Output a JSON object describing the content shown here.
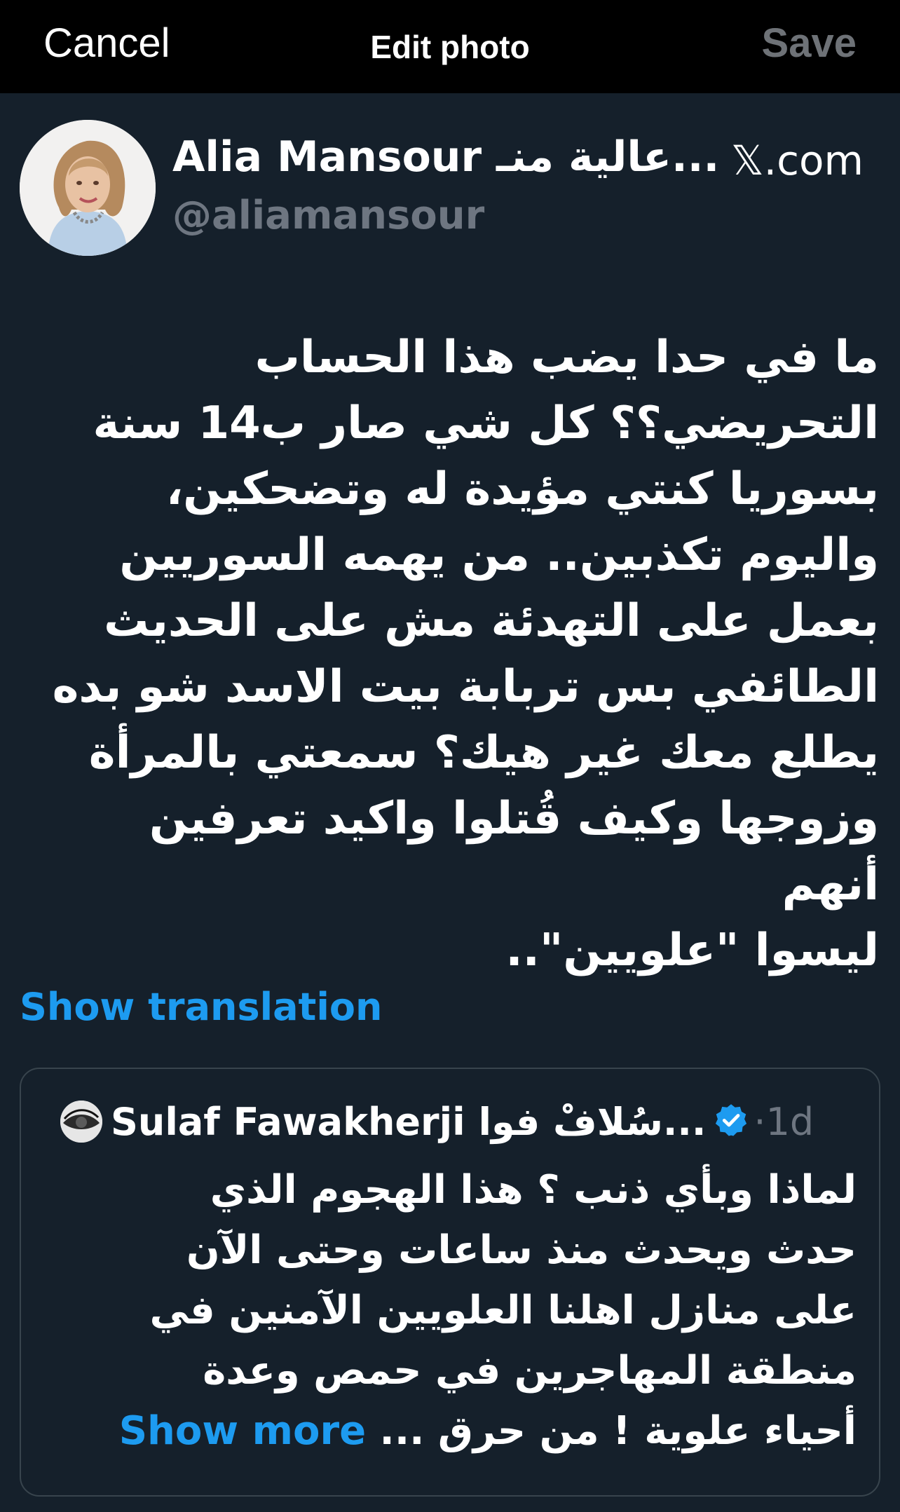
{
  "topbar": {
    "cancel_label": "Cancel",
    "title": "Edit photo",
    "save_label": "Save",
    "save_color": "#6e7277"
  },
  "tweet": {
    "display_name": "Alia Mansour عالية منـ...",
    "handle": "@aliamansour",
    "source": "𝕏.com",
    "avatar_icon": "profile-photo",
    "body_lines": [
      "ما في حدا يضب هذا الحساب",
      "التحريضي؟؟ كل شي صار ب14 سنة",
      "بسوريا كنتي مؤيدة له وتضحكين،",
      "واليوم تكذبين.. من يهمه السوريين",
      "بعمل على التهدئة مش على الحديث",
      "الطائفي بس تربابة بيت الاسد شو بده",
      "يطلع معك غير هيك؟ سمعتي بالمرأة",
      "وزوجها وكيف قُتلوا واكيد تعرفين أنهم",
      "ليسوا \"علويين\".."
    ],
    "show_translation": "Show translation"
  },
  "quote": {
    "display_name": "Sulaf Fawakherji سُلافْ فوا...",
    "verified_icon": "verified-badge-icon",
    "time": "1d",
    "body_lines": [
      "لماذا وبأي ذنب ؟ هذا الهجوم الذي",
      "حدث ويحدث منذ ساعات وحتى الآن",
      "على منازل اهلنا العلويين الآمنين في",
      "منطقة المهاجرين في حمص وعدة",
      "أحياء علوية ! من حرق ..."
    ],
    "show_more": "Show more"
  },
  "colors": {
    "background": "#15202b",
    "topbar": "#000000",
    "link": "#1d9bf0",
    "muted": "#6e7681",
    "card_border": "#38444d"
  }
}
